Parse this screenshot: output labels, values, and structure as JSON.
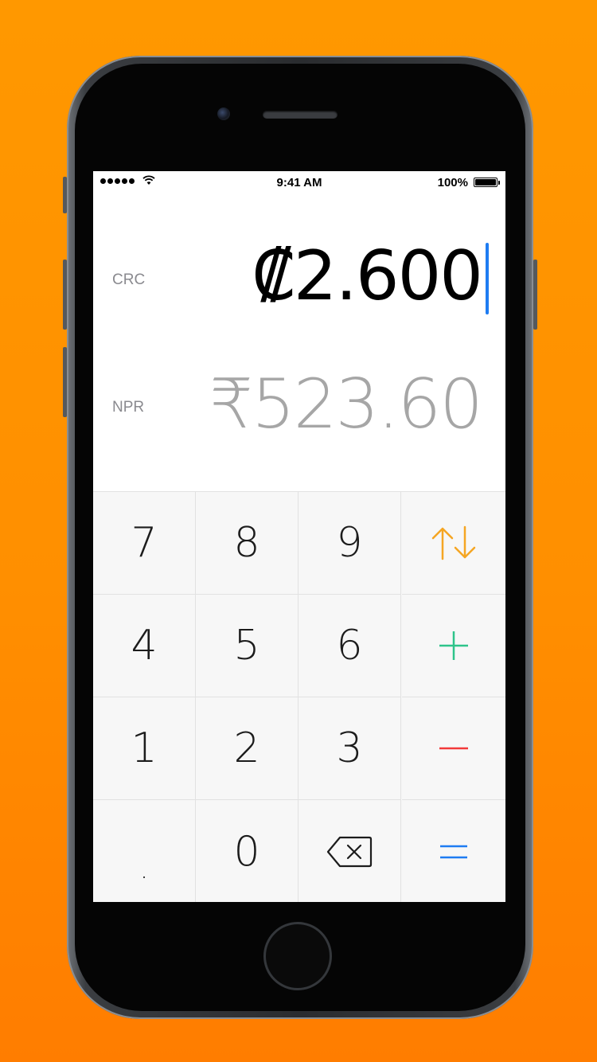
{
  "status_bar": {
    "time": "9:41 AM",
    "battery_percent": "100%",
    "signal_dots": 5
  },
  "converter": {
    "from": {
      "code": "CRC",
      "amount": "₡2.600"
    },
    "to": {
      "code": "NPR",
      "amount": "₹523.60"
    }
  },
  "keypad": {
    "keys": [
      [
        "7",
        "8",
        "9",
        "swap-icon"
      ],
      [
        "4",
        "5",
        "6",
        "plus-icon"
      ],
      [
        "1",
        "2",
        "3",
        "minus-icon"
      ],
      [
        ".",
        "0",
        "backspace-icon",
        "equals-icon"
      ]
    ],
    "k7": "7",
    "k8": "8",
    "k9": "9",
    "k4": "4",
    "k5": "5",
    "k6": "6",
    "k1": "1",
    "k2": "2",
    "k3": "3",
    "kdot": ".",
    "k0": "0"
  },
  "colors": {
    "background": "#ff8f00",
    "swap": "#f5a623",
    "plus": "#2ec48a",
    "minus": "#f23a3a",
    "equals": "#1e7cf2",
    "caret": "#1e7cf2"
  }
}
